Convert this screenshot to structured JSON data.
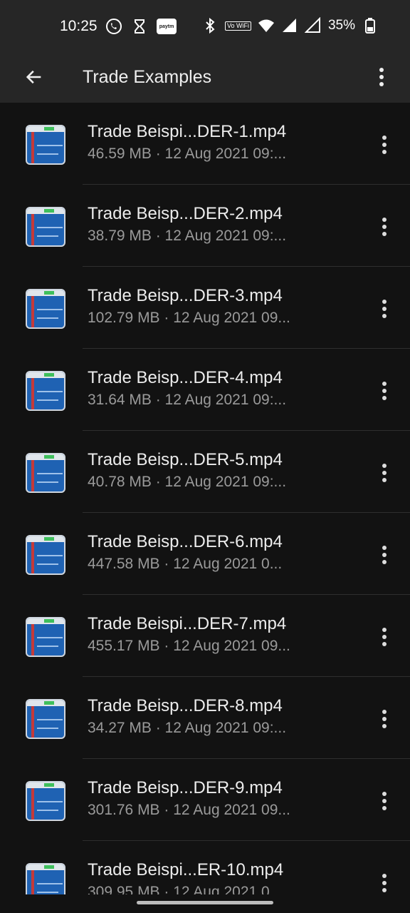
{
  "status": {
    "time": "10:25",
    "battery": "35%",
    "volte": "Vo WiFi"
  },
  "appbar": {
    "title": "Trade Examples"
  },
  "files": [
    {
      "name": "Trade Beispi...DER-1.mp4",
      "meta": "46.59 MB · 12 Aug 2021 09:..."
    },
    {
      "name": "Trade Beisp...DER-2.mp4",
      "meta": "38.79 MB · 12 Aug 2021 09:..."
    },
    {
      "name": "Trade Beisp...DER-3.mp4",
      "meta": "102.79 MB · 12 Aug 2021 09..."
    },
    {
      "name": "Trade Beisp...DER-4.mp4",
      "meta": "31.64 MB · 12 Aug 2021 09:..."
    },
    {
      "name": "Trade Beisp...DER-5.mp4",
      "meta": "40.78 MB · 12 Aug 2021 09:..."
    },
    {
      "name": "Trade Beisp...DER-6.mp4",
      "meta": "447.58 MB · 12 Aug 2021 0..."
    },
    {
      "name": "Trade Beispi...DER-7.mp4",
      "meta": "455.17 MB · 12 Aug 2021 09..."
    },
    {
      "name": "Trade Beisp...DER-8.mp4",
      "meta": "34.27 MB · 12 Aug 2021 09:..."
    },
    {
      "name": "Trade Beisp...DER-9.mp4",
      "meta": "301.76 MB · 12 Aug 2021 09..."
    },
    {
      "name": "Trade Beispi...ER-10.mp4",
      "meta": "309.95 MB · 12 Aug 2021 0..."
    }
  ]
}
